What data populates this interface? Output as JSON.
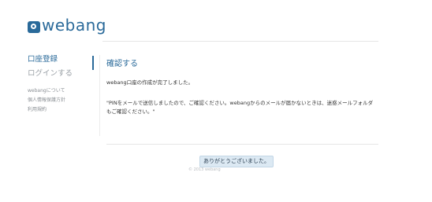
{
  "logo": {
    "text": "webang",
    "tail": ""
  },
  "sidebar": {
    "items": [
      {
        "label": "口座登録",
        "active": true
      },
      {
        "label": "ログインする",
        "active": false
      }
    ],
    "sub_links": [
      {
        "label": "webangについて"
      },
      {
        "label": "個人情報保護方針"
      },
      {
        "label": "利用規約"
      }
    ]
  },
  "main": {
    "heading": "確認する",
    "message": "webang口座の作成が完了しました。",
    "note": "\"PINをメールで送信しましたので、ご確認ください。webangからのメールが届かないときは、迷惑メールフォルダもご確認ください。\""
  },
  "footer": {
    "thanks_label": "ありがとうございました。",
    "copyright": "© 2013 webang"
  },
  "colors": {
    "brand": "#2a6a9a",
    "inactive": "#9aa0a6",
    "button_bg": "#dce9f3"
  }
}
